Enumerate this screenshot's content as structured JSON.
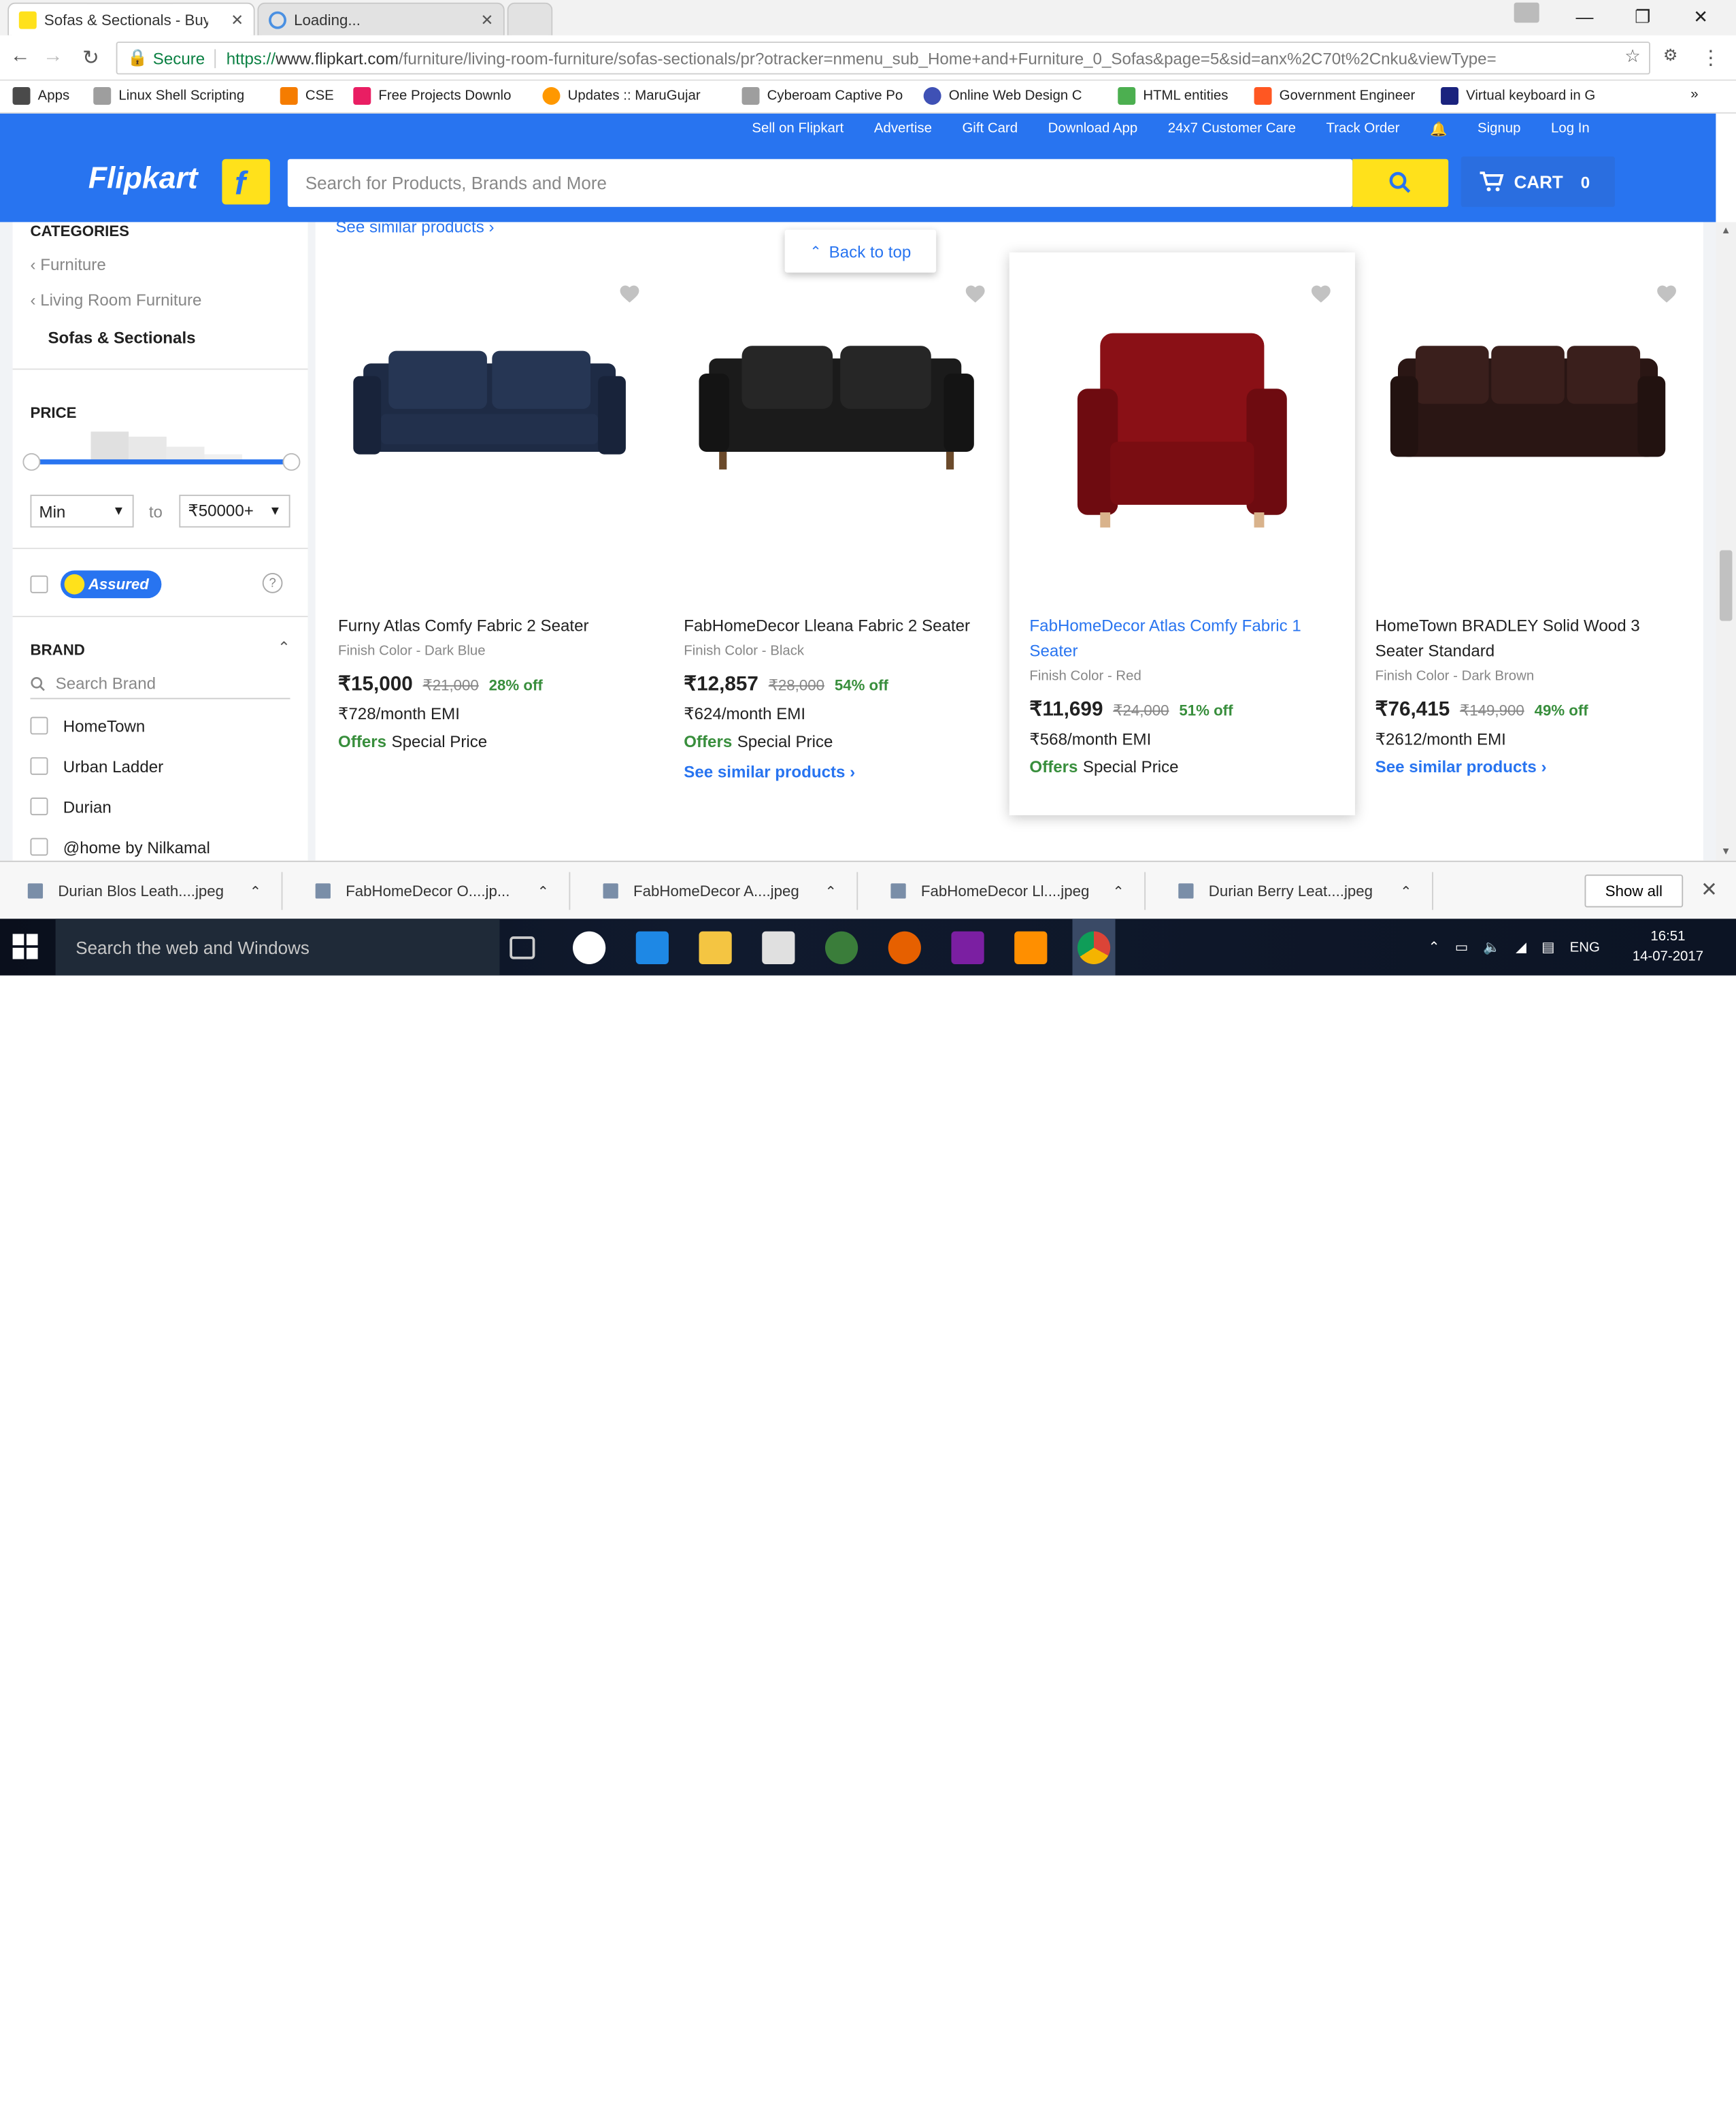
{
  "browser": {
    "tabs": [
      {
        "title": "Sofas & Sectionals - Buy",
        "active": true
      },
      {
        "title": "Loading...",
        "active": false
      }
    ],
    "secure_label": "Secure",
    "url_scheme": "https://",
    "url_host": "www.flipkart.com",
    "url_rest": "/furniture/living-room-furniture/sofas-sectionals/pr?otracker=nmenu_sub_Home+and+Furniture_0_Sofas&page=5&sid=anx%2C70t%2Cnku&viewType="
  },
  "bookmarks": [
    {
      "label": "Apps",
      "color": "#4a4a4a"
    },
    {
      "label": "Linux Shell Scripting",
      "color": "#9e9e9e"
    },
    {
      "label": "CSE",
      "color": "#f57c00"
    },
    {
      "label": "Free Projects Downlo",
      "color": "#e91e63"
    },
    {
      "label": "Updates :: MaruGujar",
      "color": "#ff9800"
    },
    {
      "label": "Cyberoam Captive Po",
      "color": "#9e9e9e"
    },
    {
      "label": "Online Web Design C",
      "color": "#3f51b5"
    },
    {
      "label": "HTML entities",
      "color": "#4caf50"
    },
    {
      "label": "Government Engineer",
      "color": "#ff5722"
    },
    {
      "label": "Virtual keyboard in G",
      "color": "#1a237e"
    }
  ],
  "header": {
    "top_links": [
      "Sell on Flipkart",
      "Advertise",
      "Gift Card",
      "Download App",
      "24x7 Customer Care",
      "Track Order",
      "Signup",
      "Log In"
    ],
    "logo": "Flipkart",
    "search_placeholder": "Search for Products, Brands and More",
    "cart_label": "CART",
    "cart_count": "0",
    "brand_color": "#2874f0",
    "accent_color": "#ffe11b"
  },
  "sidebar": {
    "categories_label": "CATEGORIES",
    "crumbs": [
      "Furniture",
      "Living Room Furniture"
    ],
    "current_category": "Sofas & Sectionals",
    "price_label": "PRICE",
    "price_min": "Min",
    "price_to": "to",
    "price_max": "₹50000+",
    "assured_label": "Assured",
    "help_icon": "?",
    "brand_label": "BRAND",
    "brand_search_placeholder": "Search Brand",
    "brands": [
      "HomeTown",
      "Urban Ladder",
      "Durian",
      "@home by Nilkamal"
    ]
  },
  "main": {
    "see_similar_top": "See similar products ›",
    "back_to_top": "Back to top",
    "products": [
      {
        "title": "Furny Atlas Comfy Fabric 2 Seater",
        "finish": "Finish Color - Dark Blue",
        "price": "₹15,000",
        "mrp": "₹21,000",
        "off": "28% off",
        "emi": "₹728/month EMI",
        "offers": "Offers",
        "offer_text": "Special Price",
        "similar": "",
        "color": "#1e2b45"
      },
      {
        "title": "FabHomeDecor Lleana Fabric 2 Seater",
        "finish": "Finish Color - Black",
        "price": "₹12,857",
        "mrp": "₹28,000",
        "off": "54% off",
        "emi": "₹624/month EMI",
        "offers": "Offers",
        "offer_text": "Special Price",
        "similar": "See similar products ›",
        "color": "#1b1b1b"
      },
      {
        "title": "FabHomeDecor Atlas Comfy Fabric 1 Seater",
        "finish": "Finish Color - Red",
        "price": "₹11,699",
        "mrp": "₹24,000",
        "off": "51% off",
        "emi": "₹568/month EMI",
        "offers": "Offers",
        "offer_text": "Special Price",
        "similar": "",
        "color": "#7a0d12"
      },
      {
        "title": "HomeTown BRADLEY Solid Wood 3 Seater Standard",
        "finish": "Finish Color - Dark Brown",
        "price": "₹76,415",
        "mrp": "₹149,900",
        "off": "49% off",
        "emi": "₹2612/month EMI",
        "offers": "",
        "offer_text": "",
        "similar": "See similar products ›",
        "color": "#2a1614"
      }
    ]
  },
  "downloads": {
    "items": [
      "Durian Blos Leath....jpeg",
      "FabHomeDecor O....jp...",
      "FabHomeDecor A....jpeg",
      "FabHomeDecor Ll....jpeg",
      "Durian Berry Leat....jpeg"
    ],
    "show_all": "Show all"
  },
  "taskbar": {
    "search_placeholder": "Search the web and Windows",
    "language": "ENG",
    "time": "16:51",
    "date": "14-07-2017"
  }
}
